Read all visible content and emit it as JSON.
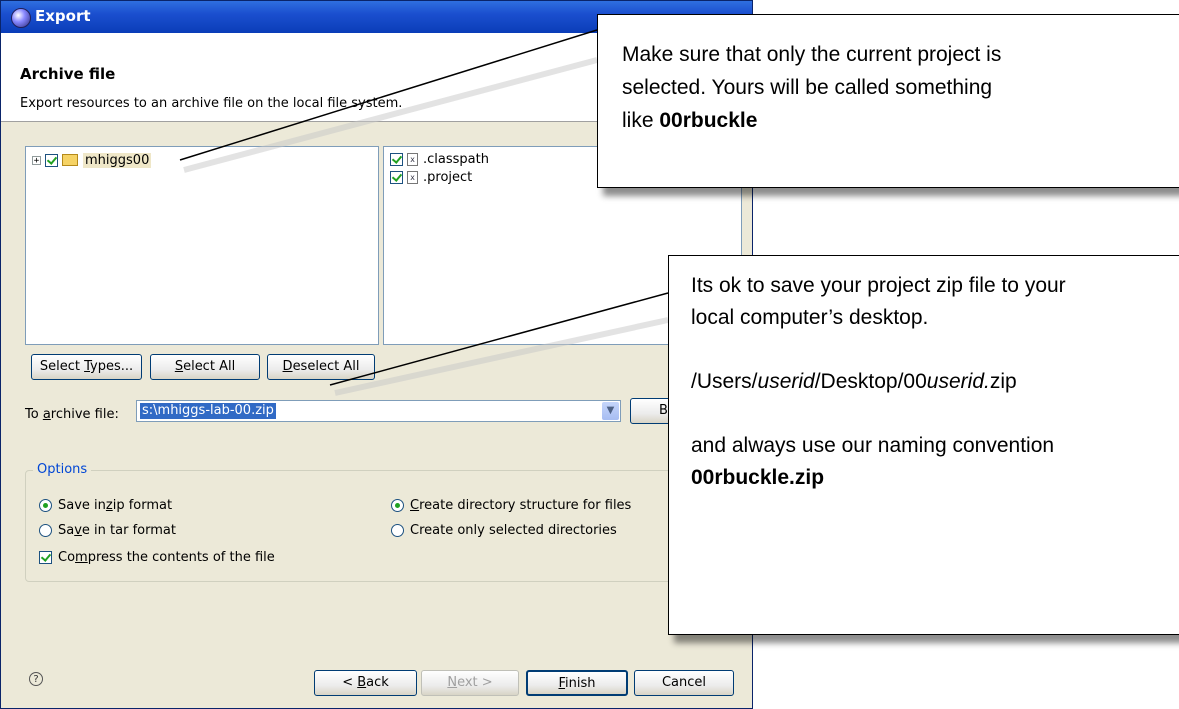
{
  "dialog": {
    "title": "Export",
    "header_title": "Archive file",
    "header_desc": "Export resources to an archive file on the local file system."
  },
  "left_tree": {
    "items": [
      {
        "label": "mhiggs00",
        "checked": true,
        "expand": "+"
      }
    ]
  },
  "right_list": {
    "items": [
      {
        "label": ".classpath",
        "checked": true
      },
      {
        "label": ".project",
        "checked": true
      }
    ]
  },
  "buttons": {
    "select_types": {
      "pre": "Select ",
      "key": "T",
      "post": "ypes..."
    },
    "select_all": {
      "pre": "",
      "key": "S",
      "post": "elect All"
    },
    "deselect_all": {
      "pre": "",
      "key": "D",
      "post": "eselect All"
    },
    "browse": "Bro",
    "back": {
      "pre": "< ",
      "key": "B",
      "post": "ack"
    },
    "next": {
      "pre": "",
      "key": "N",
      "post": "ext >"
    },
    "finish": {
      "pre": "",
      "key": "F",
      "post": "inish"
    },
    "cancel": "Cancel"
  },
  "archive": {
    "label_pre": "To ",
    "label_key": "a",
    "label_post": "rchive file:",
    "value": "s:\\mhiggs-lab-00.zip"
  },
  "options": {
    "legend": "Options",
    "save_zip": {
      "pre": "Save in ",
      "key": "z",
      "post": "ip format",
      "selected": true
    },
    "save_tar": {
      "pre": "Sa",
      "key": "v",
      "post": "e in tar format",
      "selected": false
    },
    "compress": {
      "pre": "Co",
      "key": "m",
      "post": "press the contents of the file",
      "checked": true
    },
    "create_dir": {
      "pre": "",
      "key": "C",
      "post": "reate directory structure for files",
      "selected": true
    },
    "create_selected": {
      "pre": "Create only selected directories",
      "selected": false
    }
  },
  "help_icon": "?",
  "callout1": {
    "line1": "Make sure that only the current project is",
    "line2": "selected.  Yours will be called something",
    "line3_pre": "like ",
    "line3_bold": "00rbuckle"
  },
  "callout2": {
    "line1": "Its ok to save your project zip file to your",
    "line2": "local computer’s desktop.",
    "path_a": "/Users/",
    "path_b": "userid",
    "path_c": "/Desktop/00",
    "path_d": "userid.",
    "path_e": "zip",
    "line4": " and always use our naming convention",
    "line5_bold": "00rbuckle.zip"
  }
}
